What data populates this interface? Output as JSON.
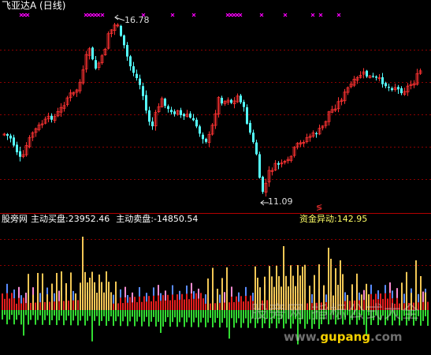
{
  "header": {
    "title": "飞亚达A (日线)"
  },
  "price_chart": {
    "high_label": "16.78",
    "low_label": "11.09",
    "signal_glyph": "≶"
  },
  "indicator": {
    "site_label": "股旁网",
    "buy_label": "主动买盘:",
    "buy_value": "23952.46",
    "sell_label": "主动卖盘:",
    "sell_value": "-14850.54",
    "fund_label": "资金异动:",
    "fund_value": "142.95"
  },
  "watermark": {
    "main": "股旁网 指标公式大全",
    "url_prefix": "www.",
    "url_highlight": "gupang",
    "url_suffix": ".com"
  },
  "colors": {
    "up": "#ff3232",
    "down": "#54ffff",
    "marker": "#ff00ff",
    "buy_bar": "#ffd25a",
    "sell_bar": "#32dc32",
    "red_bar": "#e61e1e",
    "blue_bar": "#5a8cff",
    "pink_bar": "#ff8cd2",
    "grid": "#8b0000",
    "separator": "#b40000"
  }
}
